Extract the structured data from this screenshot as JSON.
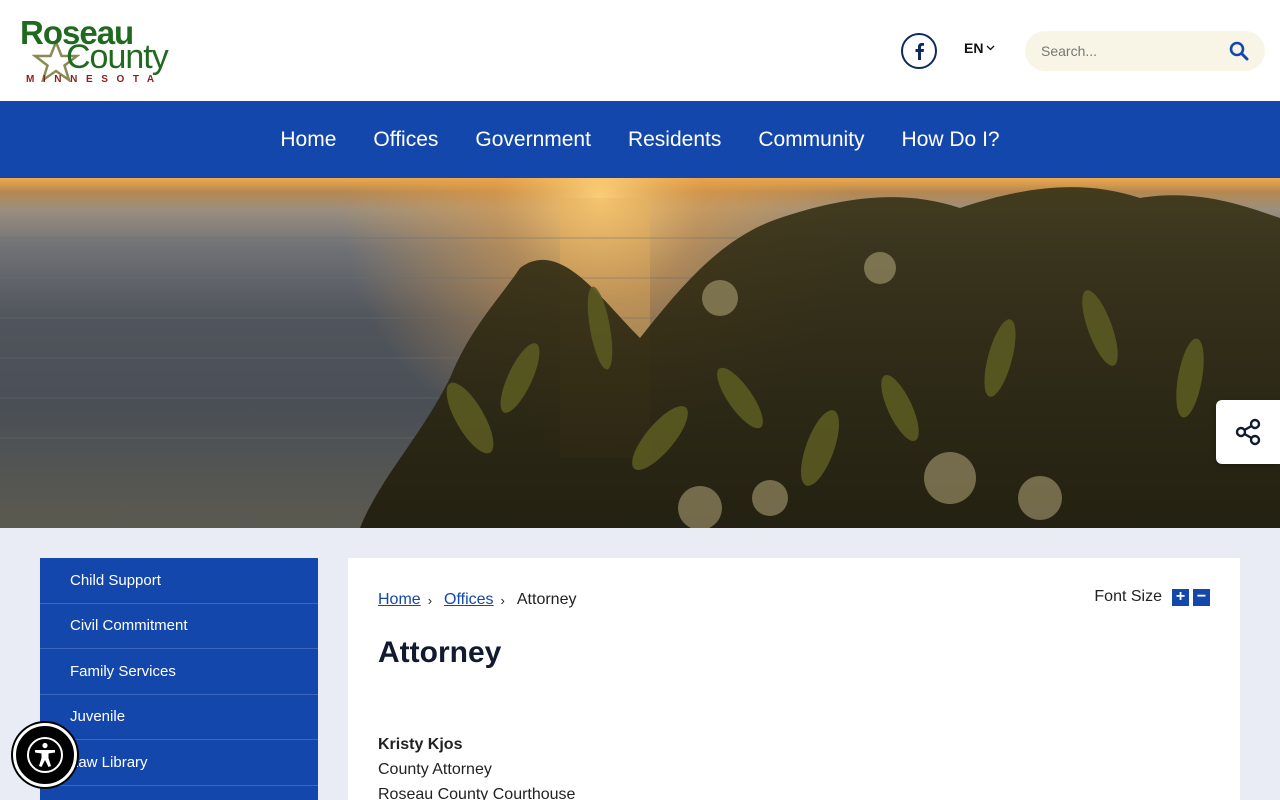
{
  "logo": {
    "line1": "Roseau",
    "line2": "County",
    "line3": "MINNESOTA"
  },
  "header": {
    "language": "EN",
    "search": {
      "placeholder": "Search..."
    }
  },
  "nav": [
    {
      "label": "Home"
    },
    {
      "label": "Offices"
    },
    {
      "label": "Government"
    },
    {
      "label": "Residents"
    },
    {
      "label": "Community"
    },
    {
      "label": "How Do I?"
    }
  ],
  "sidebar": {
    "items": [
      {
        "label": "Child Support"
      },
      {
        "label": "Civil Commitment"
      },
      {
        "label": "Family Services"
      },
      {
        "label": "Juvenile"
      },
      {
        "label": "Law Library"
      }
    ]
  },
  "breadcrumb": [
    {
      "label": "Home"
    },
    {
      "label": "Offices"
    },
    {
      "label": "Attorney"
    }
  ],
  "font_size": {
    "label": "Font Size",
    "increase": "+",
    "decrease": "−"
  },
  "page": {
    "title": "Attorney",
    "contact_name": "Kristy Kjos",
    "contact_role": "County Attorney",
    "contact_address": "Roseau County Courthouse"
  },
  "colors": {
    "brand_blue": "#1447ab",
    "logo_green": "#1f6a1f",
    "logo_red": "#8a1f1f"
  },
  "icons": [
    "facebook-icon",
    "chevron-down-icon",
    "search-icon",
    "share-icon",
    "accessibility-icon"
  ]
}
